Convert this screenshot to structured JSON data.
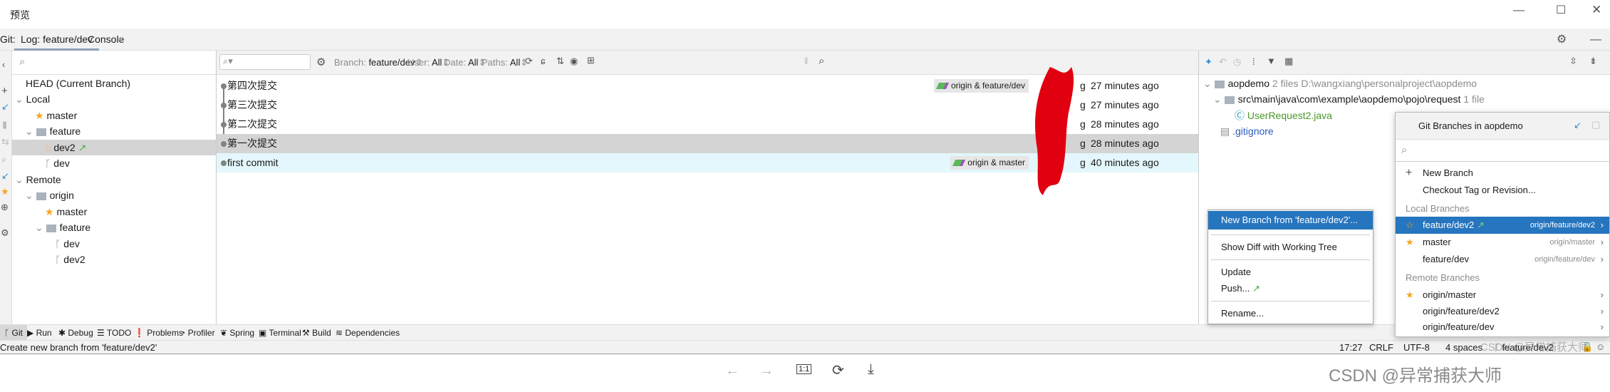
{
  "window": {
    "title": "预览",
    "controls": [
      "minimize",
      "maximize",
      "close"
    ]
  },
  "tabs": {
    "prefix": "Git:",
    "items": [
      {
        "label": "Log: feature/dev",
        "active": true
      },
      {
        "label": "Console",
        "closable": true
      }
    ]
  },
  "branch_tree": {
    "items": [
      {
        "label": "HEAD (Current Branch)",
        "level": 0
      },
      {
        "label": "Local",
        "level": 0,
        "expanded": true
      },
      {
        "label": "master",
        "level": 1,
        "icon": "star-icon"
      },
      {
        "label": "feature",
        "level": 1,
        "icon": "folder-icon",
        "expanded": true
      },
      {
        "label": "dev2",
        "level": 2,
        "icon": "tag-icon",
        "selected": true,
        "outgoing": true
      },
      {
        "label": "dev",
        "level": 2,
        "icon": "branch-icon"
      },
      {
        "label": "Remote",
        "level": 0,
        "expanded": true
      },
      {
        "label": "origin",
        "level": 1,
        "icon": "folder-icon",
        "expanded": true
      },
      {
        "label": "master",
        "level": 2,
        "icon": "star-icon"
      },
      {
        "label": "feature",
        "level": 2,
        "icon": "folder-icon",
        "expanded": true
      },
      {
        "label": "dev",
        "level": 3,
        "icon": "branch-icon"
      },
      {
        "label": "dev2",
        "level": 3,
        "icon": "branch-icon"
      }
    ]
  },
  "log_toolbar": {
    "search_placeholder": "",
    "filters": [
      {
        "label": "Branch:",
        "value": "feature/dev"
      },
      {
        "label": "User:",
        "value": "All"
      },
      {
        "label": "Date:",
        "value": "All"
      },
      {
        "label": "Paths:",
        "value": "All"
      }
    ]
  },
  "commits": [
    {
      "message": "第四次提交",
      "refs": "origin & feature/dev",
      "author": "g",
      "date": "27 minutes ago"
    },
    {
      "message": "第三次提交",
      "refs": "",
      "author": "g",
      "date": "27 minutes ago"
    },
    {
      "message": "第二次提交",
      "refs": "",
      "author": "g",
      "date": "28 minutes ago"
    },
    {
      "message": "第一次提交",
      "refs": "",
      "author": "g",
      "date": "28 minutes ago",
      "selected": true
    },
    {
      "message": "first commit",
      "refs": "origin & master",
      "author": "g",
      "date": "40 minutes ago",
      "current": true
    }
  ],
  "changes": {
    "root": {
      "name": "aopdemo",
      "count": "2 files",
      "path": "D:\\wangxiang\\personalproject\\aopdemo"
    },
    "dir": {
      "name": "src\\main\\java\\com\\example\\aopdemo\\pojo\\request",
      "count": "1 file"
    },
    "files": [
      {
        "name": "UserRequest2.java",
        "color": "#4a9a2a"
      },
      {
        "name": ".gitignore",
        "color": "#2a5ab8"
      }
    ]
  },
  "branches_popup": {
    "title": "Git Branches in aopdemo",
    "actions": [
      "New Branch",
      "Checkout Tag or Revision..."
    ],
    "local_header": "Local Branches",
    "local": [
      {
        "name": "feature/dev2",
        "tracking": "origin/feature/dev2",
        "selected": true,
        "outgoing": true,
        "icon": "star-outline-icon"
      },
      {
        "name": "master",
        "tracking": "origin/master",
        "icon": "star-icon"
      },
      {
        "name": "feature/dev",
        "tracking": "origin/feature/dev"
      }
    ],
    "remote_header": "Remote Branches",
    "remote": [
      {
        "name": "origin/master",
        "icon": "star-icon"
      },
      {
        "name": "origin/feature/dev2"
      },
      {
        "name": "origin/feature/dev"
      }
    ]
  },
  "context_menu": {
    "items": [
      "New Branch from 'feature/dev2'...",
      "Show Diff with Working Tree",
      "Update",
      "Push...",
      "Rename..."
    ]
  },
  "tool_windows": [
    "Git",
    "Run",
    "Debug",
    "TODO",
    "Problems",
    "Profiler",
    "Spring",
    "Terminal",
    "Build",
    "Dependencies"
  ],
  "status": {
    "message": "Create new branch from 'feature/dev2'",
    "position": "17:27",
    "line_sep": "CRLF",
    "encoding": "UTF-8",
    "indent": "4 spaces",
    "branch": "feature/dev2"
  },
  "watermark": "CSDN @异常捕获大师",
  "preview_toolbar": [
    "back",
    "forward",
    "1:1",
    "rotate",
    "download"
  ],
  "colors": {
    "selection": "#2675bf",
    "accent_star": "#f5a623",
    "outgoing": "#4caf50",
    "redaction": "#e00010"
  }
}
